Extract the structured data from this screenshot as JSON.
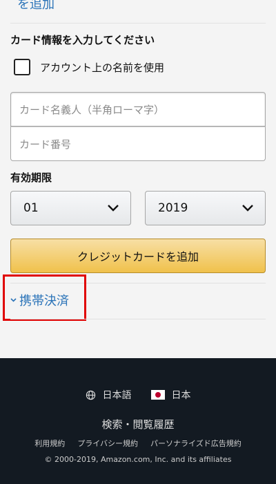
{
  "top_link": "を追加",
  "card_form": {
    "section_title": "カード情報を入力してください",
    "use_account_name_label": "アカウント上の名前を使用",
    "cardholder_placeholder": "カード名義人（半角ローマ字）",
    "card_number_placeholder": "カード番号",
    "expiry_label": "有効期限",
    "month_value": "01",
    "year_value": "2019",
    "add_card_label": "クレジットカードを追加"
  },
  "mobile_payment": {
    "label": "携帯決済"
  },
  "footer": {
    "language": "日本語",
    "region": "日本",
    "history": "検索・閲覧履歴",
    "links": [
      "利用規約",
      "プライバシー規約",
      "パーソナライズド広告規約"
    ],
    "copyright": "© 2000-2019, Amazon.com, Inc. and its affiliates"
  },
  "colors": {
    "link": "#2a73b8",
    "highlight_box": "#e00000",
    "footer_bg": "#131a22",
    "button_bg": "#f0c14b"
  }
}
